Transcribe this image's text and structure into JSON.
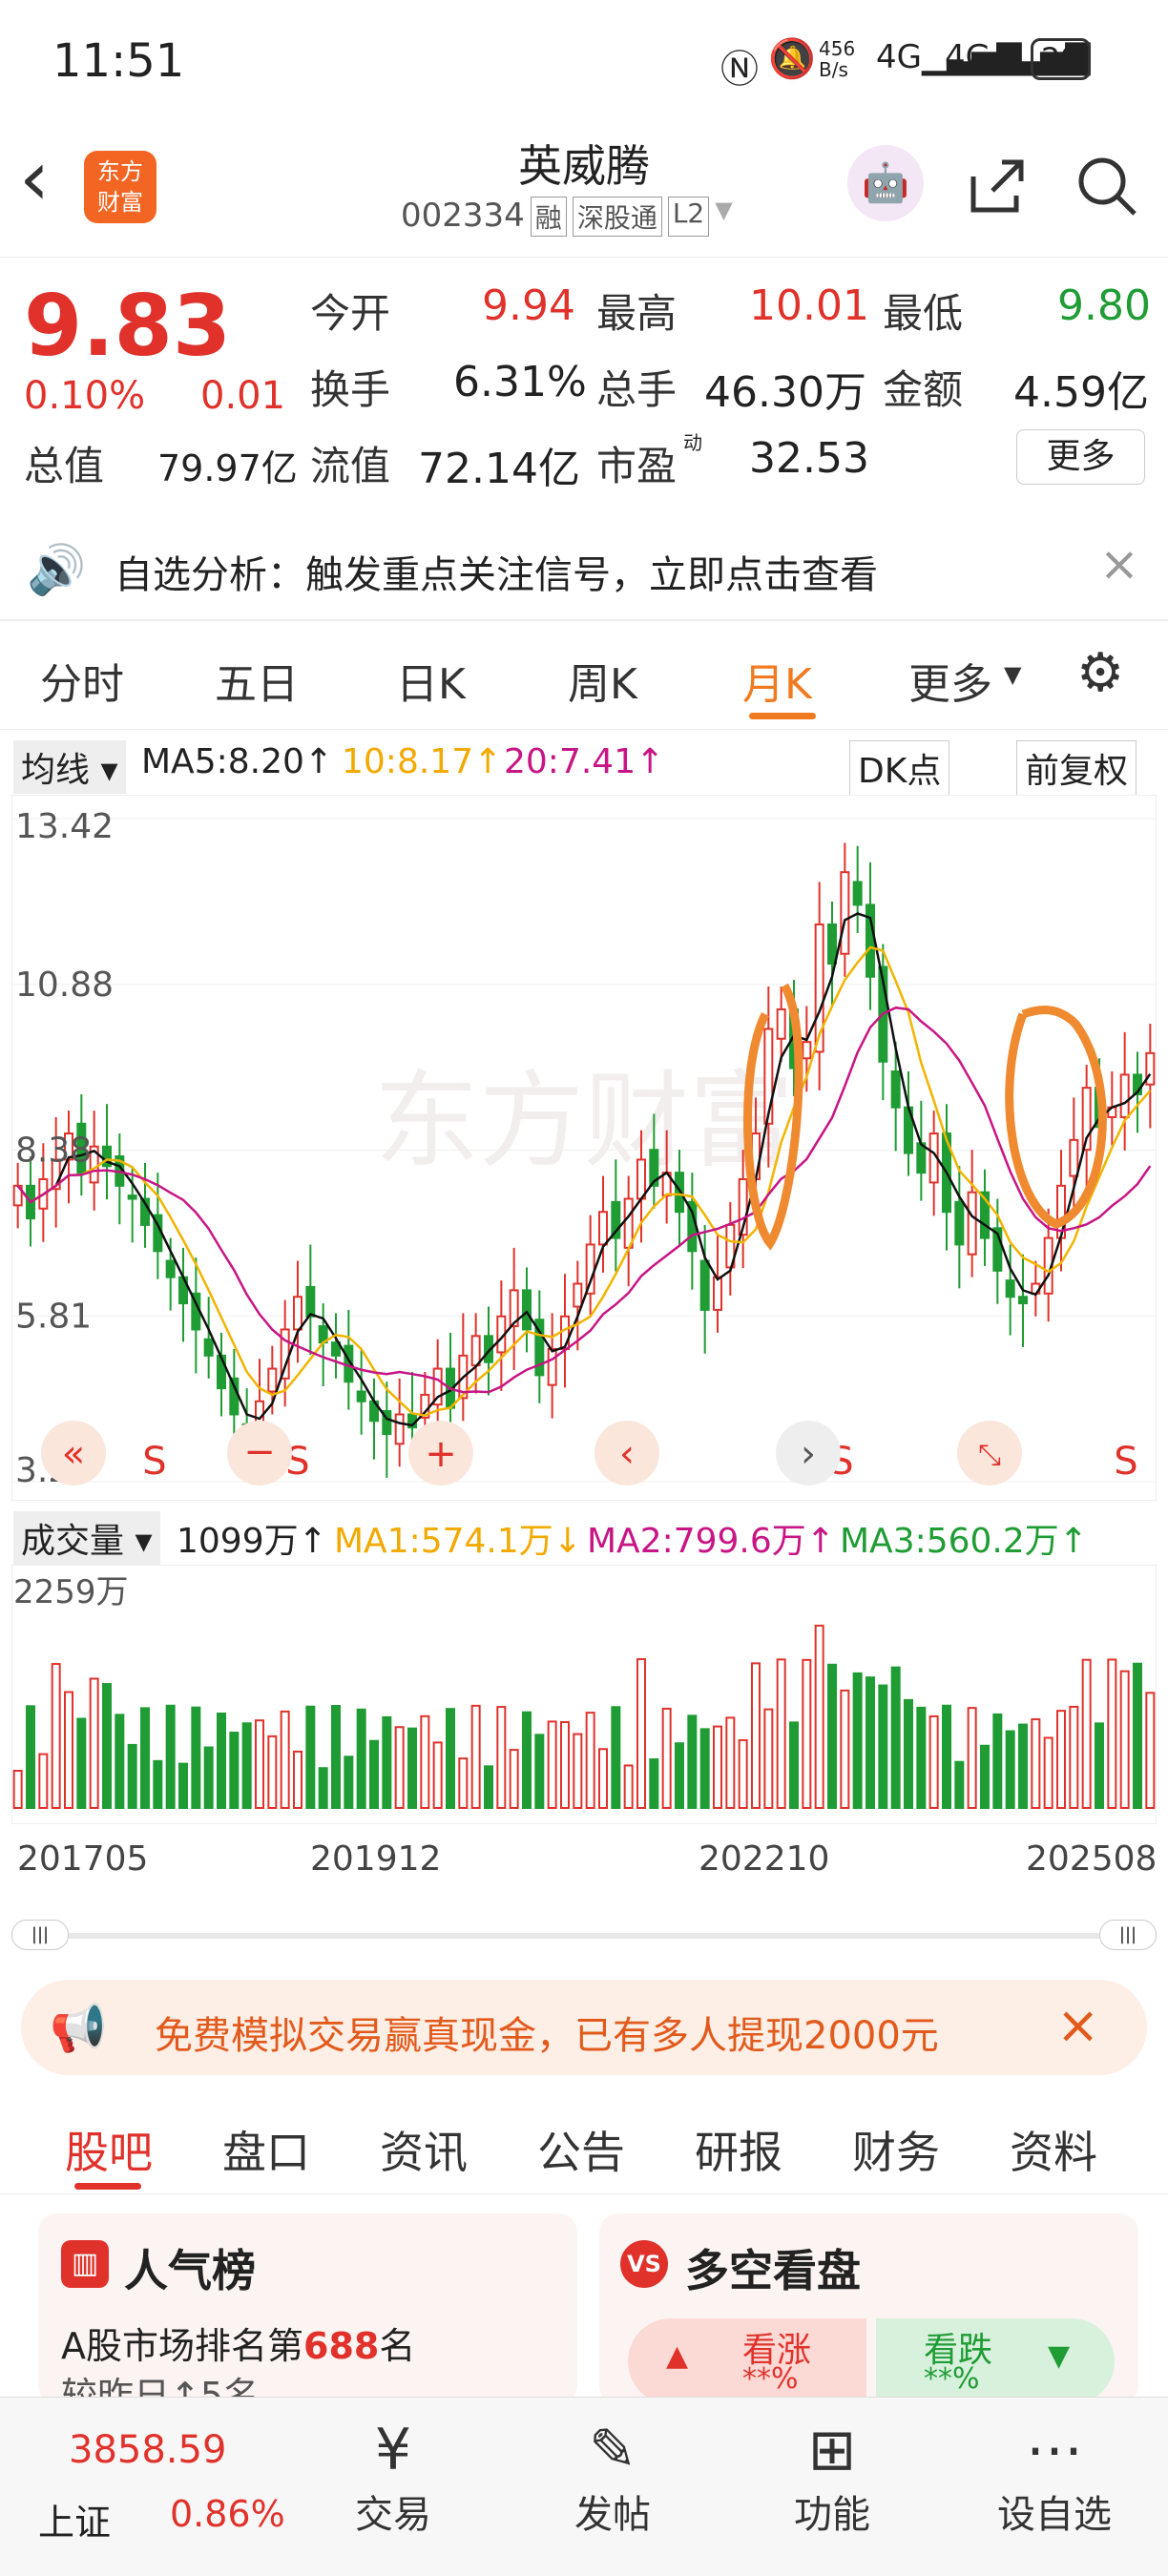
{
  "status": {
    "time": "11:51",
    "net_speed": "456\nB/s",
    "battery": "29"
  },
  "header": {
    "back_label": "‹",
    "logo_line1": "东方",
    "logo_line2": "财富",
    "name": "英威腾",
    "code": "002334",
    "tags": [
      "融",
      "深股通",
      "L2"
    ]
  },
  "quote": {
    "price": "9.83",
    "change_pct": "0.10%",
    "change": "0.01",
    "items": [
      {
        "label": "今开",
        "value": "9.94",
        "color": "red"
      },
      {
        "label": "最高",
        "value": "10.01",
        "color": "red"
      },
      {
        "label": "最低",
        "value": "9.80",
        "color": "green"
      },
      {
        "label": "换手",
        "value": "6.31%",
        "color": "black"
      },
      {
        "label": "总手",
        "value": "46.30万",
        "color": "black"
      },
      {
        "label": "金额",
        "value": "4.59亿",
        "color": "black"
      },
      {
        "label": "流值",
        "value": "72.14亿",
        "color": "black"
      },
      {
        "label": "市盈",
        "value": "32.53",
        "color": "black"
      }
    ],
    "total_value_label": "总值",
    "total_value": "79.97亿",
    "pe_sup": "动",
    "more_label": "更多"
  },
  "notice": {
    "text": "自选分析：触发重点关注信号，立即点击查看"
  },
  "tabs": [
    "分时",
    "五日",
    "日K",
    "周K",
    "月K",
    "更多"
  ],
  "active_tab": "月K",
  "ma": {
    "select": "均线",
    "ma5": "MA5:8.20↑",
    "ma10": "10:8.17↑",
    "ma20": "20:7.41↑",
    "dk": "DK点",
    "fq": "前复权"
  },
  "chart_data": {
    "type": "candlestick",
    "y_ticks": [
      "13.42",
      "10.88",
      "8.38",
      "5.81",
      "3.27"
    ],
    "ylim": [
      3.27,
      13.42
    ],
    "watermark": "东方财富",
    "signals": [
      "S",
      "S",
      "S",
      "S",
      "S"
    ],
    "close": [
      7.8,
      7.3,
      7.9,
      8.2,
      8.6,
      8.0,
      8.4,
      8.1,
      7.8,
      7.6,
      7.2,
      6.8,
      6.4,
      6.0,
      5.6,
      5.2,
      4.7,
      4.3,
      3.9,
      4.5,
      5.0,
      5.6,
      6.1,
      5.8,
      5.4,
      5.2,
      4.8,
      4.5,
      4.2,
      4.0,
      4.3,
      4.1,
      4.6,
      5.0,
      4.4,
      5.2,
      5.5,
      5.1,
      5.8,
      6.2,
      5.6,
      4.9,
      5.3,
      5.8,
      6.3,
      6.9,
      7.4,
      7.0,
      7.6,
      8.2,
      7.8,
      8.0,
      7.4,
      6.8,
      5.9,
      6.4,
      7.2,
      7.9,
      8.6,
      10.2,
      10.5,
      9.6,
      10.0,
      11.8,
      11.2,
      12.6,
      12.1,
      11.0,
      9.7,
      9.0,
      8.3,
      8.0,
      8.6,
      7.4,
      6.9,
      7.7,
      7.0,
      6.5,
      6.1,
      6.0,
      6.3,
      7.0,
      7.8,
      8.5,
      9.3,
      8.7,
      9.0,
      9.5,
      9.2,
      9.83
    ],
    "volume_top_label": "2259万",
    "x_labels": [
      "201705",
      "201912",
      "202210",
      "202508"
    ]
  },
  "volume": {
    "select": "成交量",
    "vol": "1099万↑",
    "ma1": "MA1:574.1万↓",
    "ma2": "MA2:799.6万↑",
    "ma3": "MA3:560.2万↑"
  },
  "promo": {
    "text": "免费模拟交易赢真现金，已有多人提现2000元"
  },
  "bottom_tabs": [
    "股吧",
    "盘口",
    "资讯",
    "公告",
    "研报",
    "财务",
    "资料"
  ],
  "cards": {
    "left_title": "人气榜",
    "left_line1_a": "A股市场排名第",
    "left_line1_b": "688",
    "left_line1_c": "名",
    "left_line2": "较昨日↑5名",
    "right_title": "多空看盘",
    "bull": "看涨",
    "bull_val": "**%",
    "bear": "看跌",
    "bear_val": "**%"
  },
  "index": {
    "value": "3858.59",
    "name": "上证",
    "pct": "0.86%"
  },
  "nav": [
    "交易",
    "发帖",
    "功能",
    "设自选"
  ],
  "colors": {
    "up": "#e0322b",
    "down": "#1f9c34",
    "accent": "#f07a1f"
  }
}
